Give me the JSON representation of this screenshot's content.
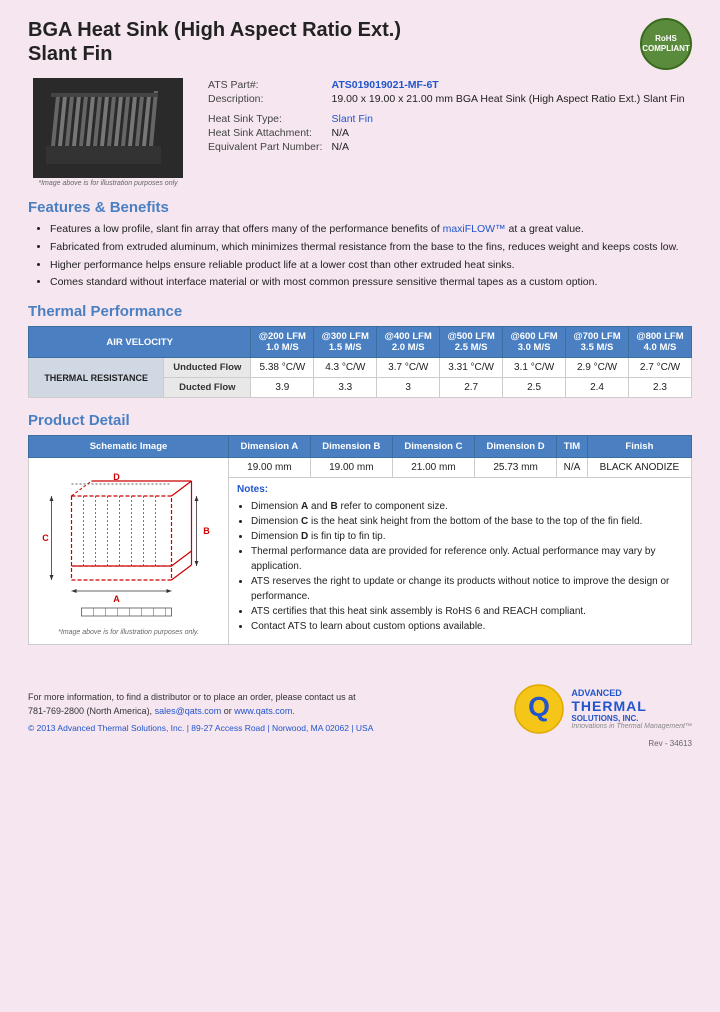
{
  "page": {
    "title_line1": "BGA Heat Sink (High Aspect Ratio Ext.)",
    "title_line2": "Slant Fin"
  },
  "rohs": {
    "line1": "RoHS",
    "line2": "COMPLIANT"
  },
  "product": {
    "part_label": "ATS Part#:",
    "part_value": "ATS019019021-MF-6T",
    "description_label": "Description:",
    "description_value": "19.00 x 19.00 x 21.00 mm BGA Heat Sink (High Aspect Ratio Ext.) Slant Fin",
    "type_label": "Heat Sink Type:",
    "type_value": "Slant Fin",
    "attachment_label": "Heat Sink Attachment:",
    "attachment_value": "N/A",
    "equiv_label": "Equivalent Part Number:",
    "equiv_value": "N/A",
    "image_caption": "*Image above is for illustration purposes only"
  },
  "sections": {
    "features_title": "Features & Benefits",
    "thermal_title": "Thermal Performance",
    "detail_title": "Product Detail"
  },
  "features": [
    "Features a low profile, slant fin array that offers many of the performance benefits of maxiFLOW™ at a great value.",
    "Fabricated from extruded aluminum, which minimizes thermal resistance from the base to the fins, reduces weight and keeps costs low.",
    "Higher performance helps ensure reliable product life at a lower cost than other extruded heat sinks.",
    "Comes standard without interface material or with most common pressure sensitive thermal tapes as a custom option."
  ],
  "thermal_table": {
    "col_headers": [
      "",
      "",
      "@200 LFM\n1.0 M/S",
      "@300 LFM\n1.5 M/S",
      "@400 LFM\n2.0 M/S",
      "@500 LFM\n2.5 M/S",
      "@600 LFM\n3.0 M/S",
      "@700 LFM\n3.5 M/S",
      "@800 LFM\n4.0 M/S"
    ],
    "row_section": "THERMAL RESISTANCE",
    "rows": [
      {
        "label": "Unducted Flow",
        "values": [
          "5.38 °C/W",
          "4.3 °C/W",
          "3.7 °C/W",
          "3.31 °C/W",
          "3.1 °C/W",
          "2.9 °C/W",
          "2.7 °C/W"
        ]
      },
      {
        "label": "Ducted Flow",
        "values": [
          "3.9",
          "3.3",
          "3",
          "2.7",
          "2.5",
          "2.4",
          "2.3"
        ]
      }
    ]
  },
  "detail_table": {
    "headers": [
      "Schematic Image",
      "Dimension A",
      "Dimension B",
      "Dimension C",
      "Dimension D",
      "TIM",
      "Finish"
    ],
    "values": [
      "19.00 mm",
      "19.00 mm",
      "21.00 mm",
      "25.73 mm",
      "N/A",
      "BLACK ANODIZE"
    ],
    "image_caption": "*Image above is for illustration purposes only."
  },
  "notes": {
    "title": "Notes:",
    "items": [
      "Dimension A and B refer to component size.",
      "Dimension C is the heat sink height from the bottom of the base to the top of the fin field.",
      "Dimension D is fin tip to fin tip.",
      "Thermal performance data are provided for reference only. Actual performance may vary by application.",
      "ATS reserves the right to update or change its products without notice to improve the design or performance.",
      "ATS certifies that this heat sink assembly is RoHS 6 and REACH compliant.",
      "Contact ATS to learn about custom options available."
    ]
  },
  "footer": {
    "contact_text": "For more information, to find a distributor or to place an order, please contact us at",
    "phone": "781-769-2800 (North America),",
    "email": "sales@qats.com",
    "email_connector": "or",
    "website": "www.qats.com.",
    "copyright": "© 2013 Advanced Thermal Solutions, Inc. | 89-27 Access Road | Norwood, MA  02062 | USA",
    "rev": "Rev - 34613",
    "ats_line1": "ADVANCED",
    "ats_line2": "THERMAL",
    "ats_line3": "SOLUTIONS, INC.",
    "ats_tagline": "Innovations in Thermal Management™"
  }
}
